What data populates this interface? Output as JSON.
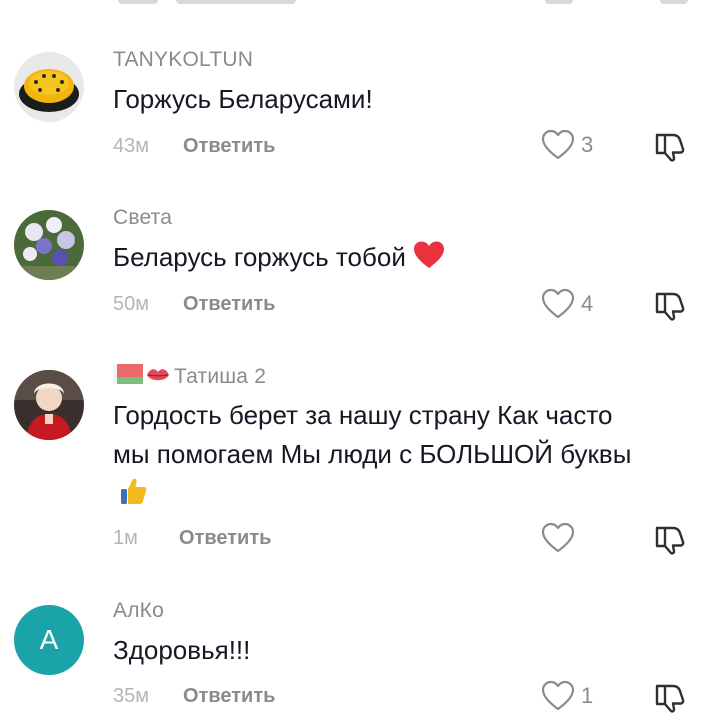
{
  "comments": [
    {
      "username": "TANYKOLTUN",
      "text": "Горжусь Беларусами!",
      "time": "43м",
      "reply_label": "Ответить",
      "likes": "3"
    },
    {
      "username": "Света",
      "text": "Беларусь горжусь тобой",
      "time": "50м",
      "reply_label": "Ответить",
      "likes": "4"
    },
    {
      "username": "Татиша 2",
      "text": "Гордость берет за нашу страну Как часто мы помогаем Мы люди с БОЛЬШОЙ буквы",
      "time": "1м",
      "reply_label": "Ответить",
      "likes": ""
    },
    {
      "username": "АлКо",
      "avatar_letter": "А",
      "text": "Здоровья!!!",
      "time": "35м",
      "reply_label": "Ответить",
      "likes": "1"
    }
  ],
  "colors": {
    "username": "#8a8b91",
    "time": "#b4b5b9",
    "avatar_letter_bg": "#1aa3a9",
    "heart_emoji": "#e8323c"
  }
}
